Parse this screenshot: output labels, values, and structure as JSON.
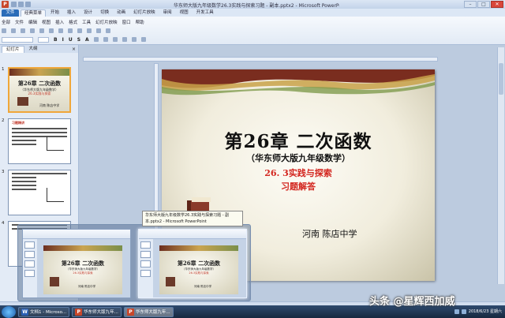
{
  "window": {
    "title": "华东师大版九年级数学26.3实践与探索习题 - 副本.pptx2 - Microsoft PowerPoint",
    "app_icon": "P",
    "controls": {
      "minimize": "–",
      "maximize": "□",
      "close": "✕"
    }
  },
  "ribbon": {
    "file_label": "文件",
    "tabs": [
      "经典菜单",
      "开始",
      "插入",
      "设计",
      "切换",
      "动画",
      "幻灯片放映",
      "审阅",
      "视图",
      "开发工具"
    ],
    "active_tab": "经典菜单",
    "menu_row": [
      "全部",
      "文件",
      "编辑",
      "视图",
      "插入",
      "格式",
      "工具",
      "幻灯片放映",
      "窗口",
      "帮助"
    ],
    "font_row": [
      "B",
      "I",
      "U",
      "S",
      "A"
    ]
  },
  "left_panel": {
    "tabs": [
      "幻灯片",
      "大纲"
    ],
    "close_glyph": "×",
    "slides": [
      {
        "num": "1",
        "title": "第26章 二次函数",
        "sub": "（华东师大版九年级数学）",
        "red": "26.3实践与探索",
        "school": "河南  陈店中学"
      },
      {
        "num": "2",
        "heading": "习题精讲"
      },
      {
        "num": "3",
        "heading": ""
      },
      {
        "num": "4",
        "heading": ""
      }
    ]
  },
  "slide": {
    "title": "第26章  二次函数",
    "subtitle": "（华东师大版九年级数学）",
    "red_line1": "26. 3实践与探索",
    "red_line2": "习题解答",
    "school": "河南      陈店中学"
  },
  "popup": {
    "tooltip": "华东师大版九年级数学26.3实践与探索习题 - 副本.pptx2 - Microsoft PowerPoint",
    "thumb_title": "第26章 二次函数",
    "thumb_sub": "（华东师大版九年级数学）",
    "thumb_red": "26.3实践与探索",
    "thumb_school": "河南   陈店中学"
  },
  "taskbar": {
    "items": [
      {
        "icon": "W",
        "kind": "w",
        "label": "文档1 - Microso..."
      },
      {
        "icon": "P",
        "kind": "p",
        "label": "华东师大版九年..."
      },
      {
        "icon": "P",
        "kind": "p",
        "label": "华东师大版九年..."
      }
    ],
    "clock_date": "2018/6/23 星期六"
  },
  "watermark": "头条 @星辉西加威",
  "colors": {
    "accent": "#2a6cb8",
    "slide_red": "#d3261f",
    "taskbar": "#17283f"
  }
}
